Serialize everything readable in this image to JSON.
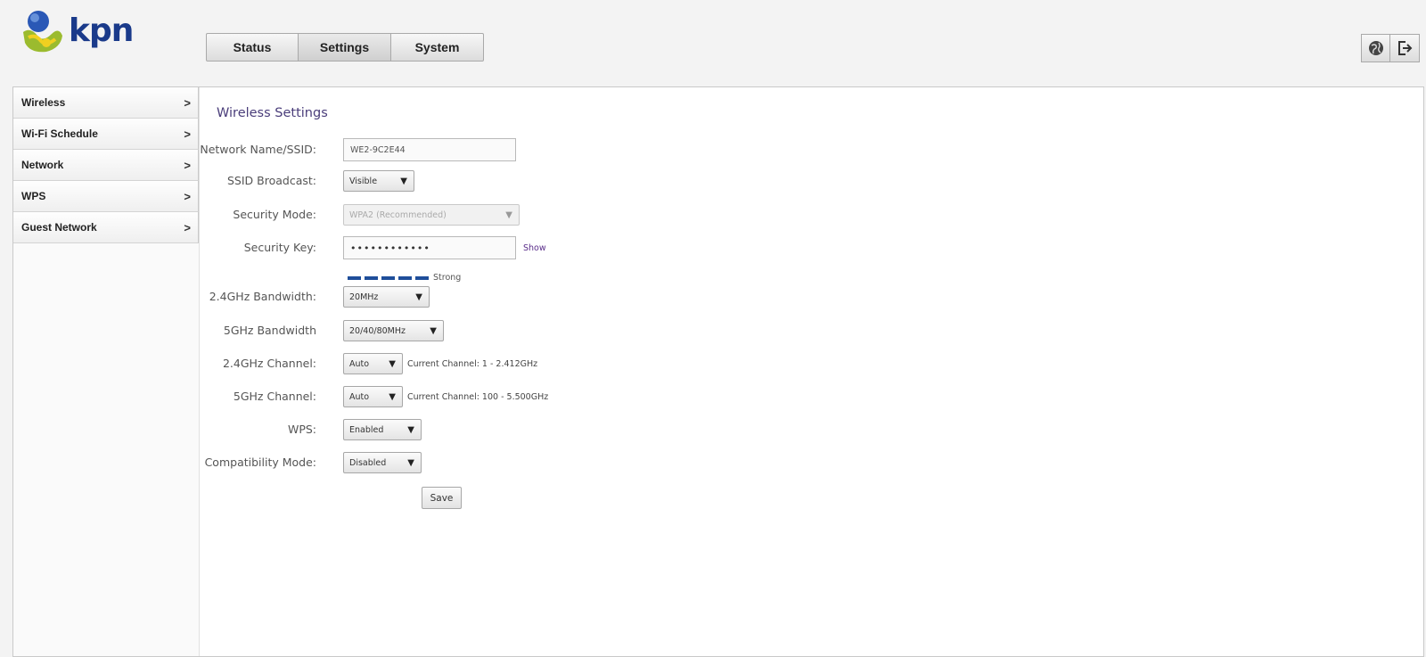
{
  "brand": {
    "name": "kpn"
  },
  "topnav": {
    "tabs": [
      "Status",
      "Settings",
      "System"
    ],
    "active": "Settings"
  },
  "topicons": [
    "globe-icon",
    "logout-icon"
  ],
  "sidebar": {
    "items": [
      {
        "label": "Wireless"
      },
      {
        "label": "Wi-Fi Schedule"
      },
      {
        "label": "Network"
      },
      {
        "label": "WPS"
      },
      {
        "label": "Guest Network"
      }
    ]
  },
  "page": {
    "title": "Wireless Settings"
  },
  "form": {
    "ssid": {
      "label": "Network Name/SSID:",
      "value": "WE2-9C2E44"
    },
    "ssid_broadcast": {
      "label": "SSID Broadcast:",
      "value": "Visible"
    },
    "security_mode": {
      "label": "Security Mode:",
      "value": "WPA2 (Recommended)"
    },
    "security_key": {
      "label": "Security Key:",
      "value": "••••••••••••",
      "show_label": "Show"
    },
    "strength": {
      "label": "Strong",
      "level": 5,
      "max": 5
    },
    "bw24": {
      "label": "2.4GHz Bandwidth:",
      "value": "20MHz"
    },
    "bw5": {
      "label": "5GHz Bandwidth",
      "value": "20/40/80MHz"
    },
    "ch24": {
      "label": "2.4GHz Channel:",
      "value": "Auto",
      "note": "Current Channel: 1 - 2.412GHz"
    },
    "ch5": {
      "label": "5GHz Channel:",
      "value": "Auto",
      "note": "Current Channel: 100 - 5.500GHz"
    },
    "wps": {
      "label": "WPS:",
      "value": "Enabled"
    },
    "compat": {
      "label": "Compatibility Mode:",
      "value": "Disabled"
    },
    "save_label": "Save"
  },
  "colors": {
    "accent": "#4a3d7a",
    "strength_bar": "#1f4e9a",
    "brand_blue": "#1a3a8a"
  }
}
